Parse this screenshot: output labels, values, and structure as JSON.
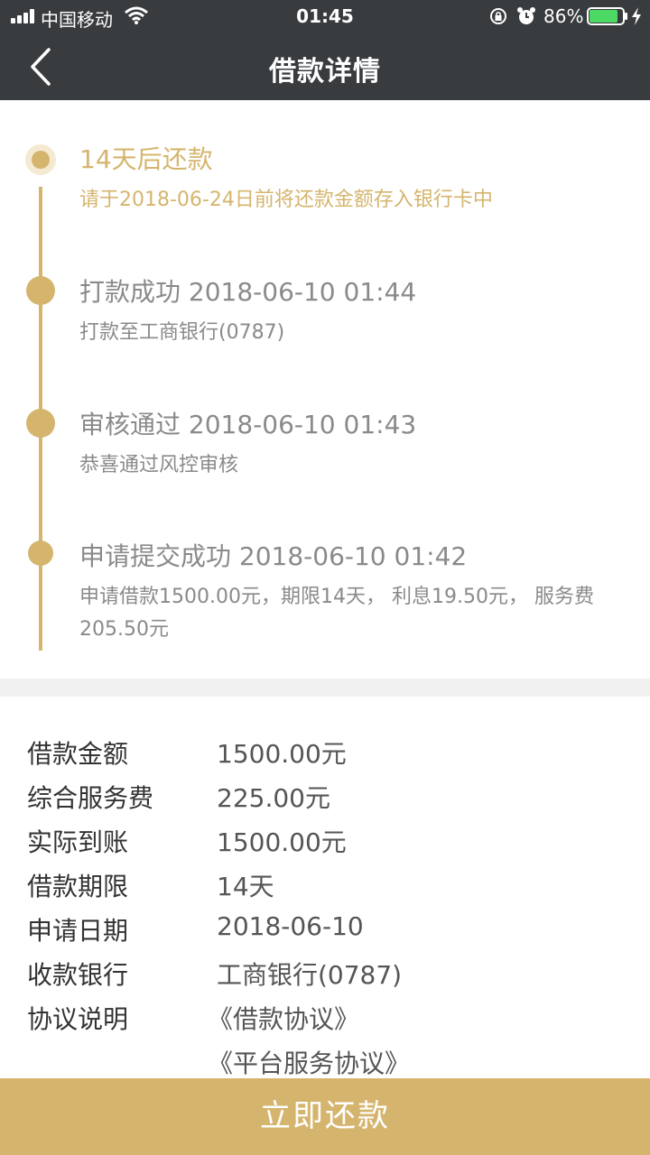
{
  "status_bar": {
    "carrier": "中国移动",
    "time": "01:45",
    "battery_percent": "86%",
    "battery_level": 0.86
  },
  "nav": {
    "title": "借款详情",
    "back_icon": "chevron-left-icon"
  },
  "timeline": [
    {
      "title": "14天后还款",
      "desc": "请于2018-06-24日前将还款金额存入银行卡中",
      "state": "current"
    },
    {
      "title": "打款成功 2018-06-10 01:44",
      "desc": "打款至工商银行(0787)",
      "state": "done"
    },
    {
      "title": "审核通过 2018-06-10 01:43",
      "desc": "恭喜通过风控审核",
      "state": "done"
    },
    {
      "title": "申请提交成功 2018-06-10 01:42",
      "desc": "申请借款1500.00元，期限14天， 利息19.50元， 服务费205.50元",
      "state": "done"
    }
  ],
  "details": {
    "rows": [
      {
        "label": "借款金额",
        "value": "1500.00元"
      },
      {
        "label": "综合服务费",
        "value": "225.00元"
      },
      {
        "label": "实际到账",
        "value": "1500.00元"
      },
      {
        "label": "借款期限",
        "value": "14天"
      },
      {
        "label": "申请日期",
        "value": "2018-06-10"
      },
      {
        "label": "收款银行",
        "value": "工商银行(0787)"
      }
    ],
    "agreement_label": "协议说明",
    "agreements": [
      "《借款协议》",
      "《平台服务协议》"
    ]
  },
  "repay_button": "立即还款",
  "colors": {
    "accent": "#d5b56e",
    "nav_bg": "#393c3f",
    "battery_green": "#4cd964"
  }
}
